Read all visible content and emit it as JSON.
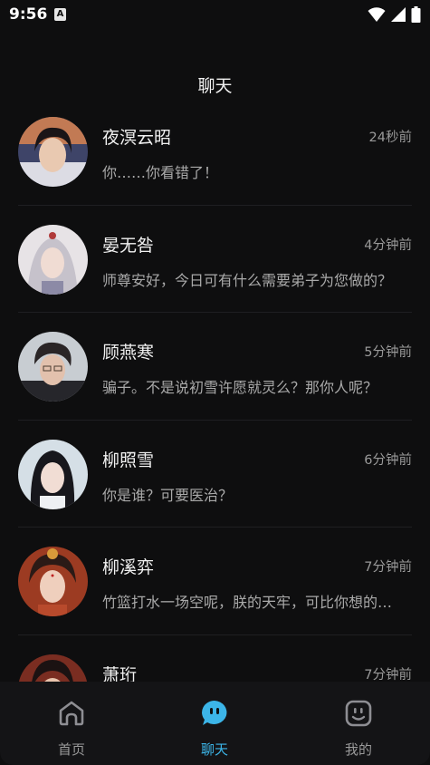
{
  "status_bar": {
    "time": "9:56",
    "a_badge": "A"
  },
  "header": {
    "title": "聊天"
  },
  "chats": [
    {
      "name": "夜溟云昭",
      "time": "24秒前",
      "preview": "你……你看错了！"
    },
    {
      "name": "晏无咎",
      "time": "4分钟前",
      "preview": "师尊安好，今日可有什么需要弟子为您做的？"
    },
    {
      "name": "顾燕寒",
      "time": "5分钟前",
      "preview": "骗子。不是说初雪许愿就灵么？那你人呢？"
    },
    {
      "name": "柳照雪",
      "time": "6分钟前",
      "preview": "你是谁？可要医治？"
    },
    {
      "name": "柳溪弈",
      "time": "7分钟前",
      "preview": "竹篮打水一场空呢，朕的天牢，可比你想的要坚固。"
    },
    {
      "name": "萧珩",
      "time": "7分钟前",
      "preview": ""
    }
  ],
  "nav": {
    "home": "首页",
    "chat": "聊天",
    "mine": "我的"
  },
  "colors": {
    "accent": "#3cb5e8",
    "background": "#0e0e0f",
    "nav_bg": "#141416"
  }
}
